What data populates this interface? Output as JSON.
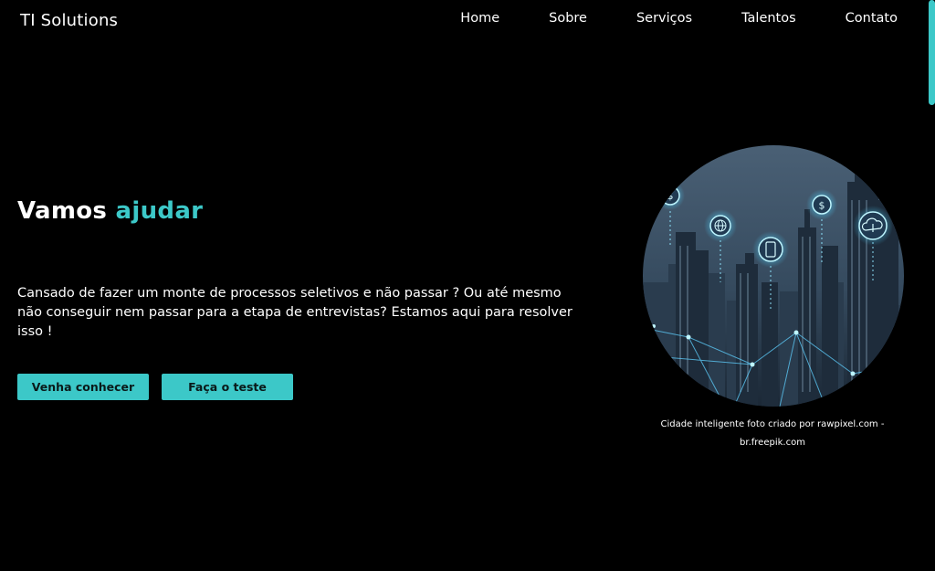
{
  "header": {
    "brand": "TI Solutions",
    "nav": [
      "Home",
      "Sobre",
      "Serviços",
      "Talentos",
      "Contato"
    ]
  },
  "hero": {
    "title_prefix": "Vamos",
    "title_accent": "ajudar",
    "text": "Cansado de fazer um monte de processos seletivos e não passar ? Ou até mesmo não conseguir nem passar para a etapa de entrevistas? Estamos aqui para resolver isso !",
    "buttons": [
      "Venha conhecer",
      "Faça o teste"
    ]
  },
  "image": {
    "caption": "Cidade inteligente foto criado por rawpixel.com - br.freepik.com"
  },
  "colors": {
    "background": "#000000",
    "accent": "#3cc8c8",
    "text": "#ffffff"
  },
  "icons": [
    "dollar-icon",
    "globe-icon",
    "phone-icon",
    "dollar-icon",
    "cloud-icon"
  ]
}
